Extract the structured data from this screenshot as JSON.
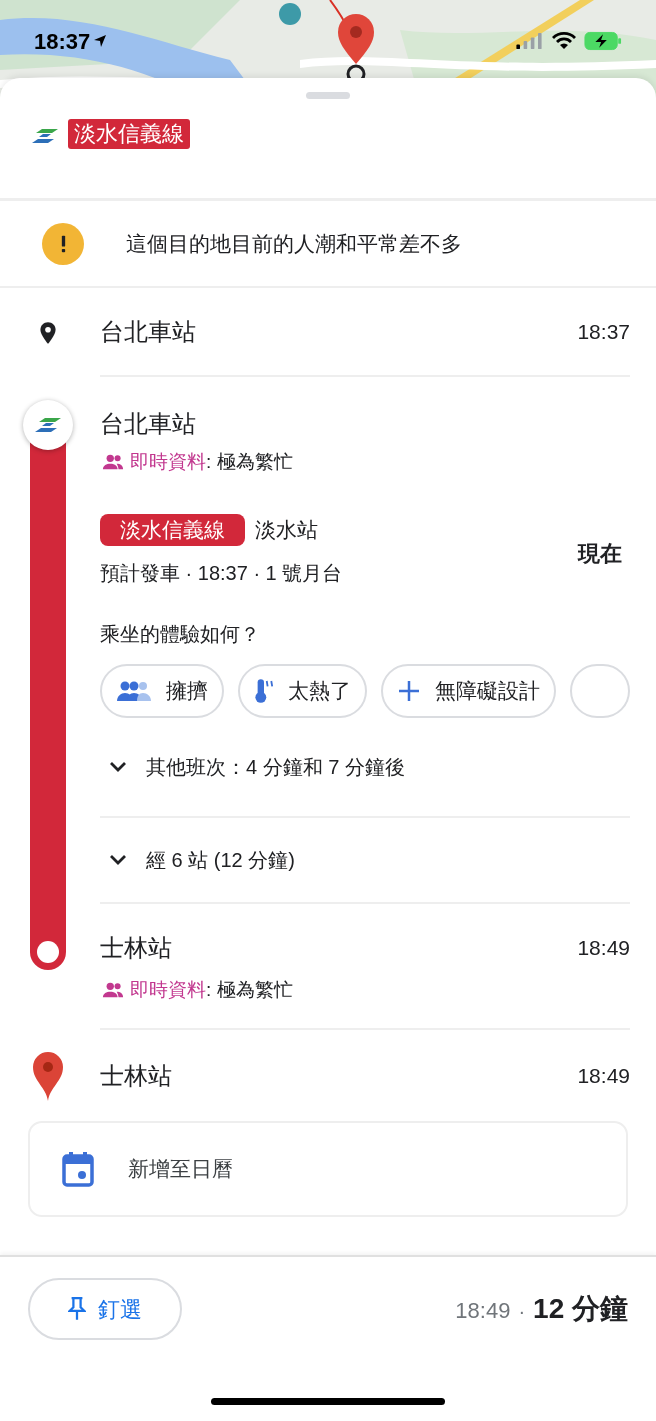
{
  "status_bar": {
    "time": "18:37"
  },
  "line_header": {
    "line_name": "淡水信義線"
  },
  "alert": {
    "text": "這個目的地目前的人潮和平常差不多"
  },
  "origin": {
    "name": "台北車站",
    "time": "18:37"
  },
  "transit": {
    "station": "台北車站",
    "crowd": {
      "label": "即時資料",
      "value": ": 極為繁忙"
    },
    "line_badge": "淡水信義線",
    "direction": "淡水站",
    "departure": "預計發車 · 18:37 · 1 號月台",
    "status": "現在",
    "question": "乘坐的體驗如何？",
    "chips": [
      {
        "kind": "crowded",
        "label": "擁擠"
      },
      {
        "kind": "hot",
        "label": "太熱了"
      },
      {
        "kind": "add",
        "label": "無障礙設計"
      }
    ],
    "other_departures": "其他班次：4 分鐘和 7 分鐘後",
    "stops": "經 6 站 (12 分鐘)",
    "arrival": {
      "station": "士林站",
      "time": "18:49",
      "crowd": {
        "label": "即時資料",
        "value": ": 極為繁忙"
      }
    }
  },
  "destination": {
    "name": "士林站",
    "time": "18:49"
  },
  "calendar": {
    "label": "新增至日曆"
  },
  "footer": {
    "pin_button": "釘選",
    "arrival": "18:49",
    "separator": "·",
    "duration": "12 分鐘"
  }
}
